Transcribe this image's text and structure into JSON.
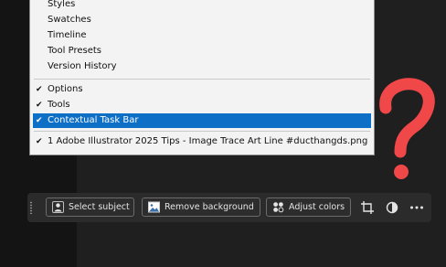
{
  "menu": {
    "items": [
      {
        "label": "Styles",
        "checked": false
      },
      {
        "label": "Swatches",
        "checked": false
      },
      {
        "label": "Timeline",
        "checked": false
      },
      {
        "label": "Tool Presets",
        "checked": false
      },
      {
        "label": "Version History",
        "checked": false
      },
      {
        "label": "Options",
        "checked": true
      },
      {
        "label": "Tools",
        "checked": true
      },
      {
        "label": "Contextual Task Bar",
        "checked": true,
        "highlighted": true
      },
      {
        "label": "1 Adobe Illustrator 2025 Tips - Image Trace Art Line #ducthangds.png",
        "checked": true
      }
    ],
    "check_glyph": "✔",
    "highlight_color": "#0d6fc6"
  },
  "taskbar": {
    "select_subject_label": "Select subject",
    "remove_background_label": "Remove background",
    "adjust_colors_label": "Adjust colors",
    "icons": [
      "person-icon",
      "image-icon",
      "adjust-colors-icon",
      "crop-icon",
      "contrast-icon",
      "more-icon"
    ]
  },
  "overlay": {
    "question_mark_color": "#f04848"
  }
}
